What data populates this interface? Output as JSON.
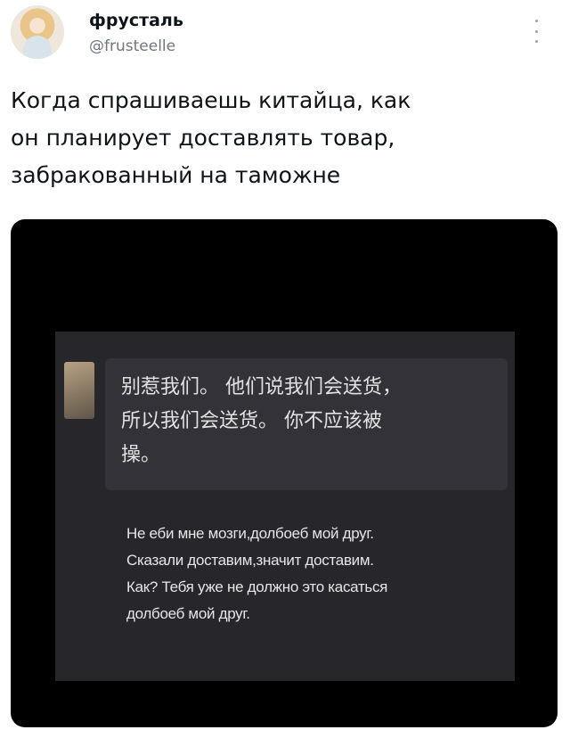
{
  "tweet": {
    "author": {
      "display_name": "фрусталь",
      "handle": "@frusteelle"
    },
    "text_lines": [
      "Когда спрашиваешь китайца, как",
      "он планирует доставлять товар,",
      "забракованный на таможне"
    ]
  },
  "media": {
    "chinese_message_lines": [
      "别惹我们。 他们说我们会送货，",
      "所以我们会送货。 你不应该被",
      "操。"
    ],
    "translation_lines": [
      "Не еби мне мозги,долбоеб мой друг.",
      "Сказали доставим,значит доставим.",
      "Как? Тебя уже не должно это касаться",
      "долбоеб мой друг."
    ]
  }
}
